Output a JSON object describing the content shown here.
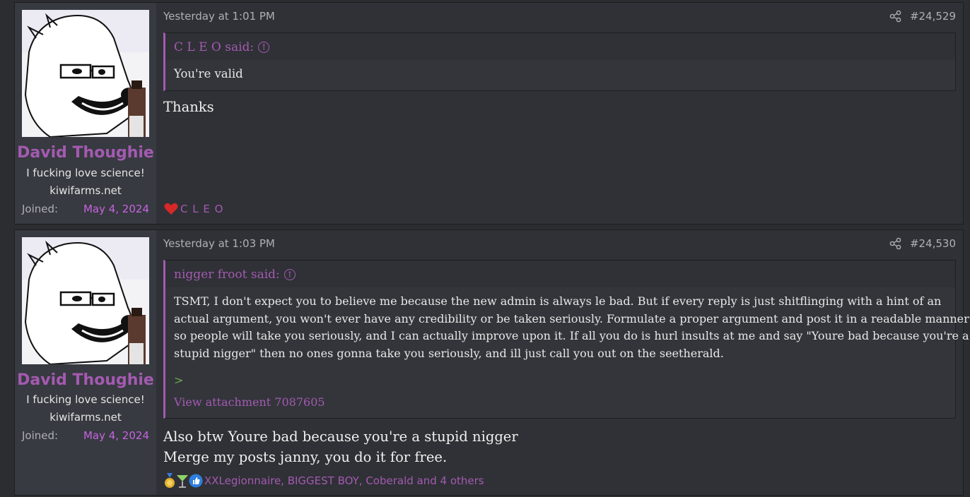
{
  "posts": [
    {
      "username": "David Thoughie",
      "user_title": "I fucking love science!",
      "user_site": "kiwifarms.net",
      "joined_label": "Joined:",
      "joined_date": "May 4, 2024",
      "date": "Yesterday at 1:01 PM",
      "post_number": "#24,529",
      "quote_author": "C L E O said:",
      "quote_text": "You're valid",
      "message_lines": [
        "Thanks"
      ],
      "reactions_text": "C L E O",
      "reaction_icons": [
        "heart-icon"
      ]
    },
    {
      "username": "David Thoughie",
      "user_title": "I fucking love science!",
      "user_site": "kiwifarms.net",
      "joined_label": "Joined:",
      "joined_date": "May 4, 2024",
      "date": "Yesterday at 1:03 PM",
      "post_number": "#24,530",
      "quote_author": "nigger froot said:",
      "quote_lines": [
        "TSMT, I don't expect you to believe me because the new admin is always le bad. But if every reply is just shitflinging with a hint of an",
        "actual argument, you won't ever have any credibility or be taken seriously. Formulate a proper argument and post it in a readable manner",
        "so people will take you seriously, and I can actually improve upon it. If all you do is hurl insults at me and say \"Youre bad because you're a",
        "stupid nigger\" then no ones gonna take you seriously, and ill just call you out on the seetherald."
      ],
      "quote_greentext": ">",
      "quote_attachment": "View attachment 7087605",
      "message_lines": [
        "Also btw Youre bad because you're a stupid nigger",
        "Merge my posts janny, you do it for free."
      ],
      "reactions_text": "XXLegionnaire, BIGGEST BOY, Coberald and 4 others",
      "reaction_icons": [
        "medal-icon",
        "cocktail-icon",
        "thumbs-up-icon"
      ]
    }
  ],
  "colors": {
    "accent": "#a45ab1",
    "joined": "#c664e0",
    "background": "#2b2d31"
  }
}
